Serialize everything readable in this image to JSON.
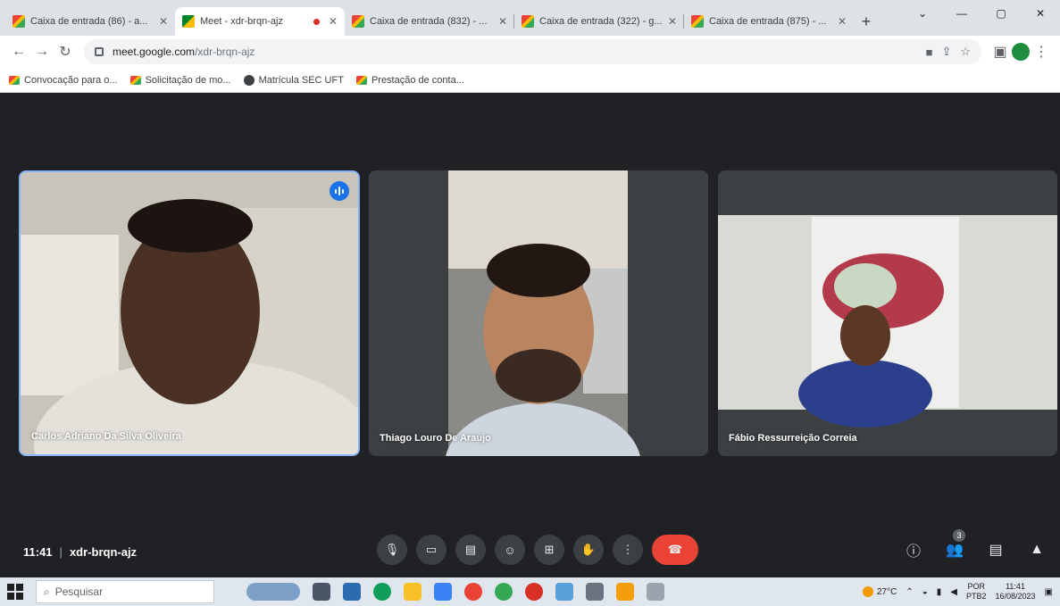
{
  "browser": {
    "tabs": [
      {
        "label": "Caixa de entrada (86) - a...",
        "favicon": "gmail-icon"
      },
      {
        "label": "Meet - xdr-brqn-ajz",
        "favicon": "meet-icon",
        "active": true,
        "recording": true
      },
      {
        "label": "Caixa de entrada (832) - ...",
        "favicon": "gmail-icon"
      },
      {
        "label": "Caixa de entrada (322) - g...",
        "favicon": "gmail-icon"
      },
      {
        "label": "Caixa de entrada (875) - ...",
        "favicon": "gmail-icon"
      }
    ],
    "url_host": "meet.google.com",
    "url_path": "/xdr-brqn-ajz",
    "bookmarks": [
      {
        "label": "Convocação para o...",
        "favicon": "gmail-icon"
      },
      {
        "label": "Solicitação de mo...",
        "favicon": "gmail-icon"
      },
      {
        "label": "Matrícula SEC UFT",
        "favicon": "globe-icon"
      },
      {
        "label": "Prestação de conta...",
        "favicon": "gmail-icon"
      }
    ]
  },
  "meet": {
    "participants": [
      {
        "name": "Carlos Adriano Da Silva Oliveira",
        "speaking": true
      },
      {
        "name": "Thiago Louro De Araujo"
      },
      {
        "name": "Fábio Ressurreição Correia"
      }
    ],
    "time": "11:41",
    "meeting_code": "xdr-brqn-ajz",
    "participant_count": "3",
    "colors": {
      "end_call": "#ea4335",
      "speaking": "#1a73e8",
      "background": "#202124"
    }
  },
  "taskbar": {
    "search_placeholder": "Pesquisar",
    "temperature": "27°C",
    "lang_top": "POR",
    "lang_bottom": "PTB2",
    "clock_time": "11:41",
    "clock_date": "16/08/2023"
  }
}
